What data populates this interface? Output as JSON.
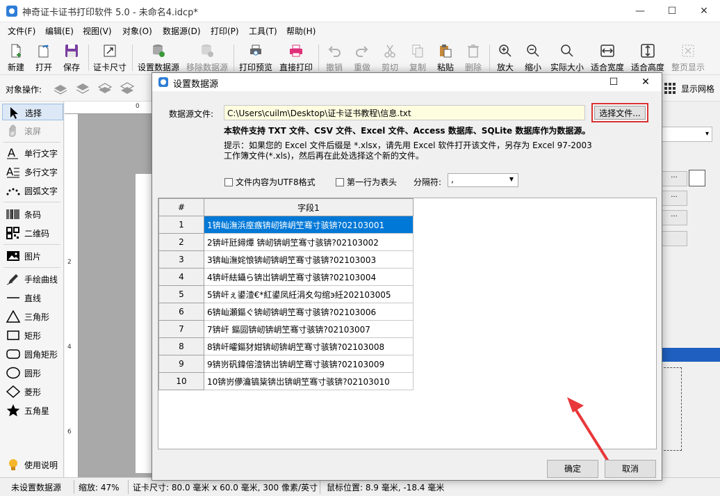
{
  "window": {
    "title": "神奇证卡证书打印软件 5.0 - 未命名4.idcp*",
    "min": "—",
    "max": "☐",
    "close": "✕"
  },
  "menu": [
    "文件(F)",
    "编辑(E)",
    "视图(V)",
    "对象(O)",
    "数据源(D)",
    "打印(P)",
    "工具(T)",
    "帮助(H)"
  ],
  "toolbar": {
    "new": "新建",
    "open": "打开",
    "save": "保存",
    "card_size": "证卡尺寸",
    "set_datasource": "设置数据源",
    "remove_datasource": "移除数据源",
    "print_preview": "打印预览",
    "direct_print": "直接打印",
    "undo": "撤销",
    "redo": "重做",
    "cut": "剪切",
    "copy": "复制",
    "paste": "粘贴",
    "delete": "删除",
    "zoom_in": "放大",
    "zoom_out": "缩小",
    "actual_size": "实际大小",
    "fit_width": "适合宽度",
    "fit_height": "适合高度",
    "full_page": "整页显示"
  },
  "objbar": {
    "label": "对象操作:",
    "show_grid": "显示网格"
  },
  "left_panel": {
    "select": "选择",
    "scroll": "滚屏",
    "single_text": "单行文字",
    "multi_text": "多行文字",
    "arc_text": "圆弧文字",
    "barcode": "条码",
    "qrcode": "二维码",
    "image": "图片",
    "freehand": "手绘曲线",
    "line": "直线",
    "triangle": "三角形",
    "rectangle": "矩形",
    "round_rect": "圆角矩形",
    "circle": "圆形",
    "diamond": "菱形",
    "star": "五角星",
    "help": "使用说明"
  },
  "ruler": {
    "top0": "0",
    "left2": "2",
    "left4": "4",
    "left6": "6"
  },
  "status": {
    "datasource": "未设置数据源",
    "zoom": "缩放: 47%",
    "card_size": "证卡尺寸: 80.0 毫米 x 60.0 毫米, 300 像素/英寸",
    "mouse": "鼠标位置: 8.9 毫米, -18.4 毫米"
  },
  "dialog": {
    "title": "设置数据源",
    "max": "☐",
    "close": "✕",
    "ds_label": "数据源文件:",
    "ds_path": "C:\\Users\\cuilm\\Desktop\\证卡证书教程\\信息.txt",
    "choose_btn": "选择文件...",
    "support": "本软件支持 TXT 文件、CSV 文件、Excel 文件、Access 数据库、SQLite 数据库作为数据源。",
    "hint1": "提示：如果您的 Excel 文件后缀是 *.xlsx，请先用 Excel 软件打开该文件，另存为 Excel 97-2003",
    "hint2": "工作簿文件(*.xls)，然后再在此处选择这个新的文件。",
    "utf8": "文件内容为UTF8格式",
    "first_row_header": "第一行为表头",
    "sep_label": "分隔符:",
    "sep_value": ",",
    "ok": "确定",
    "cancel": "取消",
    "table": {
      "headers": [
        "#",
        "字段1"
      ],
      "rows": [
        [
          "1",
          "1锛屾潕浜庢瘯锛屻锛岄笁骞寸骇锛?02103001"
        ],
        [
          "2",
          "2锛屽瓩鐞燂 锛屻锛岄笁骞寸骇锛?02103002"
        ],
        [
          "3",
          "3锛屾潕姹悢锛屻锛岄笁骞寸骇锛?02103003"
        ],
        [
          "4",
          "4锛屽紶鑷ら锛岀锛岄笁骞寸骇锛?02103004"
        ],
        [
          "5",
          "5锛屽ぇ鍙潱€*紅鍙凤紝涓夊勾绾э紝202103005"
        ],
        [
          "6",
          "6锛屾瀬鏂ぐ锛屻锛岄笁骞寸骇锛?02103006"
        ],
        [
          "7",
          "7锛屽 鏂囩锛屻锛岄笁骞寸骇锛?02103007"
        ],
        [
          "8",
          "8锛屽皬鏂犲姏锛屻锛岄笁骞寸骇锛?02103008"
        ],
        [
          "9",
          "9锛岃矾鍏傛潱锛岀锛岄笁骞寸骇锛?02103009"
        ],
        [
          "10",
          "10锛岃儚瀹镐粊锛岀锛岄笁骞寸骇锛?02103010"
        ]
      ]
    }
  }
}
